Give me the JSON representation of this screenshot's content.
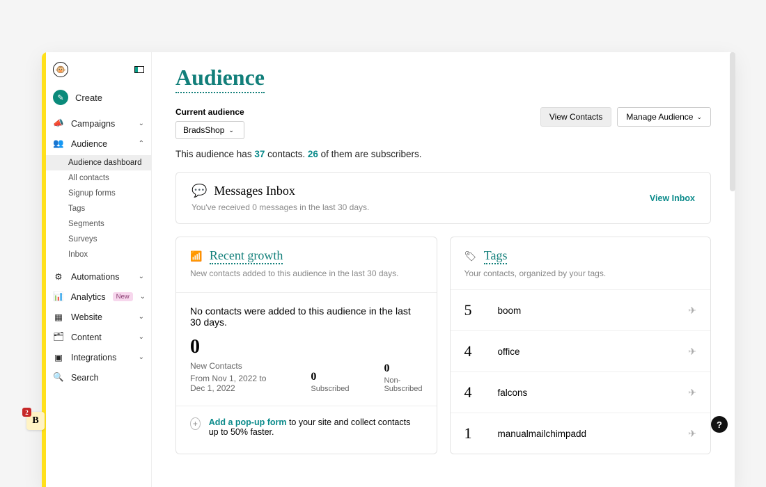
{
  "sidebar": {
    "create": "Create",
    "items": {
      "campaigns": "Campaigns",
      "audience": "Audience",
      "automations": "Automations",
      "analytics": "Analytics",
      "analytics_badge": "New",
      "website": "Website",
      "content": "Content",
      "integrations": "Integrations",
      "search": "Search"
    },
    "audience_sub": {
      "dashboard": "Audience dashboard",
      "all_contacts": "All contacts",
      "signup_forms": "Signup forms",
      "tags": "Tags",
      "segments": "Segments",
      "surveys": "Surveys",
      "inbox": "Inbox"
    }
  },
  "corner": {
    "letter": "B",
    "badge": "2"
  },
  "page": {
    "title": "Audience",
    "current_audience_label": "Current audience",
    "audience_name": "BradsShop",
    "view_contacts": "View Contacts",
    "manage_audience": "Manage Audience",
    "summary_prefix": "This audience has ",
    "summary_contacts": "37",
    "summary_mid": " contacts. ",
    "summary_subs": "26",
    "summary_suffix": " of them are subscribers."
  },
  "messages": {
    "title": "Messages Inbox",
    "subtitle": "You've received 0 messages in the last 30 days.",
    "view": "View Inbox"
  },
  "growth": {
    "title": "Recent growth",
    "subtitle": "New contacts added to this audience in the last 30 days.",
    "no_contacts": "No contacts were added to this audience in the last 30 days.",
    "big_number": "0",
    "new_contacts_label": "New Contacts",
    "date_range": "From Nov 1, 2022 to Dec 1, 2022",
    "subscribed_num": "0",
    "subscribed_label": "Subscribed",
    "nonsub_num": "0",
    "nonsub_label": "Non-Subscribed",
    "tip_link": "Add a pop-up form",
    "tip_rest": " to your site and collect contacts up to 50% faster."
  },
  "tags": {
    "title": "Tags",
    "subtitle": "Your contacts, organized by your tags.",
    "rows": {
      "r0": {
        "count": "5",
        "name": "boom"
      },
      "r1": {
        "count": "4",
        "name": "office"
      },
      "r2": {
        "count": "4",
        "name": "falcons"
      },
      "r3": {
        "count": "1",
        "name": "manualmailchimpadd"
      }
    }
  }
}
